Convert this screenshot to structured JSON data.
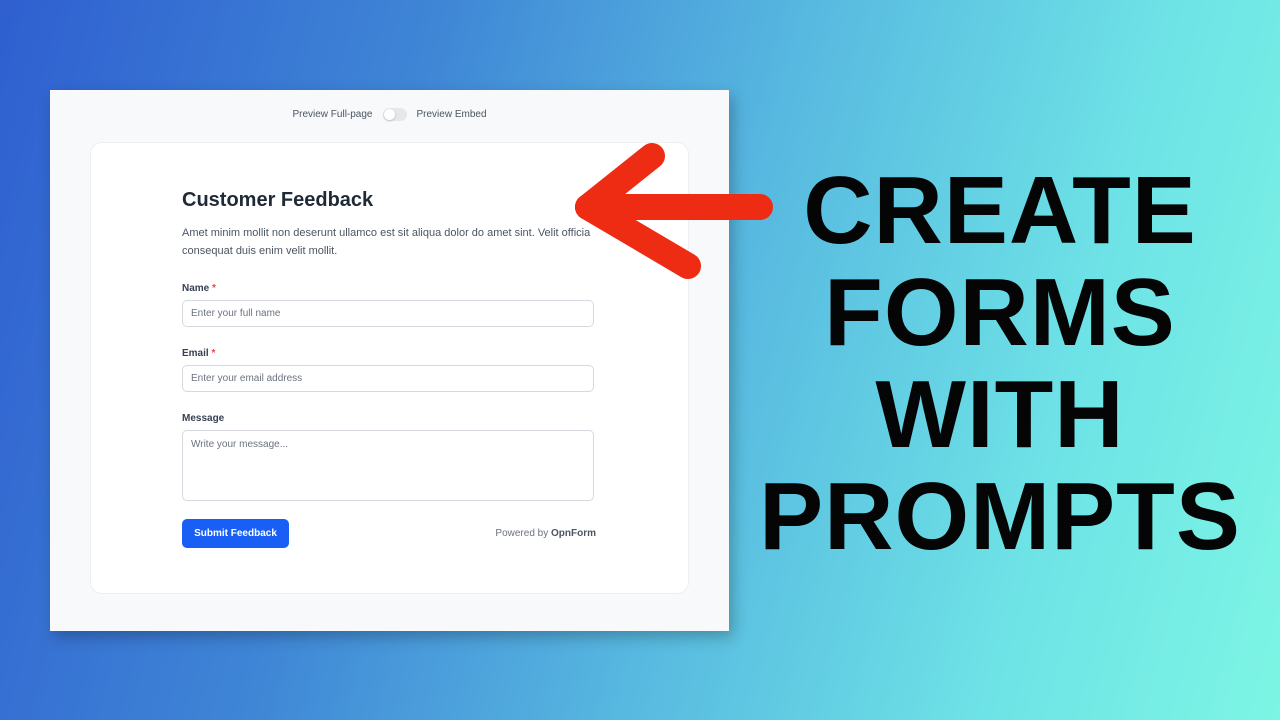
{
  "preview": {
    "left_label": "Preview Full-page",
    "right_label": "Preview Embed"
  },
  "form": {
    "title": "Customer Feedback",
    "description": "Amet minim mollit non deserunt ullamco est sit aliqua dolor do amet sint. Velit officia consequat duis enim velit mollit.",
    "fields": [
      {
        "label": "Name",
        "required_mark": "*",
        "placeholder": "Enter your full name"
      },
      {
        "label": "Email",
        "required_mark": "*",
        "placeholder": "Enter your email address"
      },
      {
        "label": "Message",
        "placeholder": "Write your message..."
      }
    ],
    "submit_label": "Submit Feedback",
    "powered_prefix": "Powered by",
    "powered_brand": "OpnForm"
  },
  "headline": {
    "lines": [
      "CREATE",
      "FORMS",
      "WITH",
      "PROMPTS"
    ]
  },
  "colors": {
    "accent": "#1a5ff5",
    "arrow": "#ee2b13",
    "required": "#ef4444"
  },
  "icons": {
    "arrow": "red-arrow-left-icon"
  }
}
